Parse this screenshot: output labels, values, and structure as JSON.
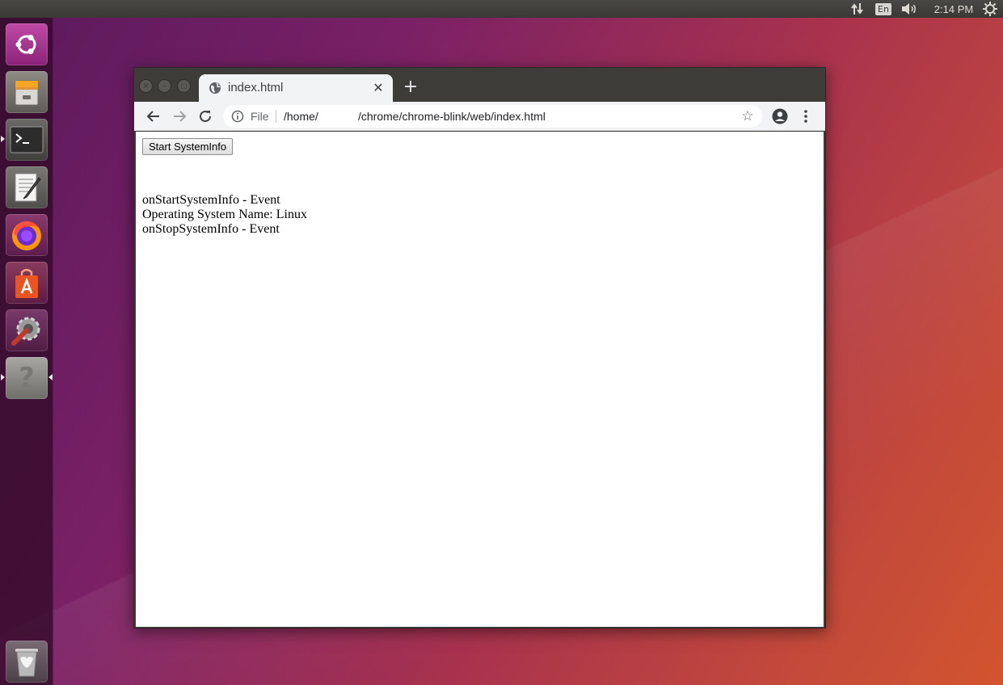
{
  "top_panel": {
    "language": "En",
    "time": "2:14 PM"
  },
  "launcher": {
    "items": [
      {
        "name": "ubuntu-dash",
        "icon": "ubuntu-logo-icon"
      },
      {
        "name": "files",
        "icon": "file-cabinet-icon"
      },
      {
        "name": "terminal",
        "icon": "terminal-icon"
      },
      {
        "name": "text-editor",
        "icon": "text-editor-icon"
      },
      {
        "name": "firefox",
        "icon": "firefox-icon"
      },
      {
        "name": "software-center",
        "icon": "shopping-bag-icon"
      },
      {
        "name": "system-settings",
        "icon": "settings-wrench-icon"
      },
      {
        "name": "unknown-app",
        "icon": "question-mark-icon"
      },
      {
        "name": "trash",
        "icon": "trash-icon"
      }
    ]
  },
  "browser": {
    "tab": {
      "title": "index.html"
    },
    "omnibox": {
      "scheme_label": "File",
      "url_part1": "/home/",
      "url_part2": "/chrome/chrome-blink/web/index.html"
    }
  },
  "page": {
    "start_button": "Start SystemInfo",
    "log_lines": [
      "onStartSystemInfo - Event",
      "Operating System Name: Linux",
      "onStopSystemInfo - Event"
    ]
  },
  "colors": {
    "launcher_bg": "#320a28",
    "panel_bg": "#3c3b37",
    "chrome_toolbar": "#f1f3f4"
  }
}
